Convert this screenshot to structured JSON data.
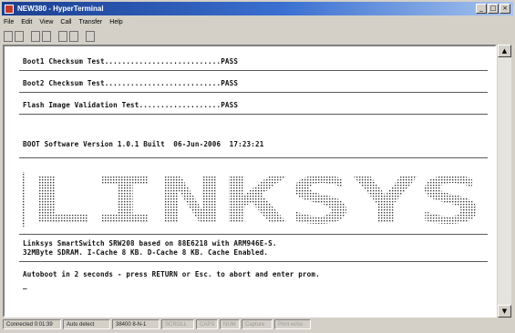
{
  "window": {
    "title": "NEW380 - HyperTerminal",
    "minimize_glyph": "_",
    "maximize_glyph": "□",
    "close_glyph": "×"
  },
  "menu": [
    "File",
    "Edit",
    "View",
    "Call",
    "Transfer",
    "Help"
  ],
  "toolbar": {
    "buttons": [
      "new-icon",
      "open-icon",
      "disconnect-icon",
      "connect-icon",
      "send-icon",
      "receive-icon",
      "properties-icon"
    ]
  },
  "terminal": {
    "lines": {
      "boot1": "Boot1 Checksum Test...........................PASS",
      "boot2": "Boot2 Checksum Test...........................PASS",
      "flash": "Flash Image Validation Test...................PASS",
      "version": "BOOT Software Version 1.0.1 Built  06-Jun-2006  17:23:21",
      "system1": "Linksys SmartSwitch SRW208 based on 88E6218 with ARM946E-S.",
      "system2": "32MByte SDRAM. I-Cache 8 KB. D-Cache 8 KB. Cache Enabled.",
      "autoboot": "Autoboot in 2 seconds - press RETURN or Esc. to abort and enter prom.",
      "cursor": "_"
    },
    "banner_text": "LINKSYS"
  },
  "scrollbar": {
    "up": "▲",
    "down": "▼"
  },
  "statusbar": [
    "Connected 0:01:39",
    "Auto detect",
    "38400 8-N-1",
    "SCROLL",
    "CAPS",
    "NUM",
    "Capture",
    "Print echo"
  ]
}
